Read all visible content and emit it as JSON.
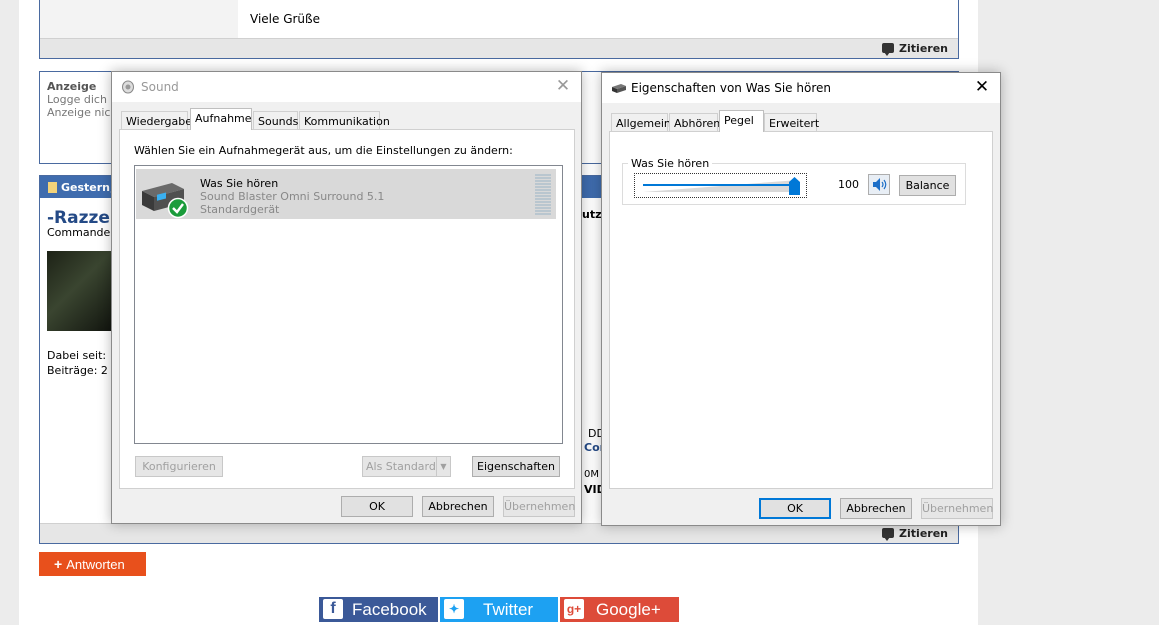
{
  "forum": {
    "greeting": "Viele Grüße",
    "quote_label": "Zitieren",
    "ad_title": "Anzeige",
    "ad_line1": "Logge dich",
    "ad_line2": "Anzeige nic",
    "post_date": "Gestern,",
    "username": "-Razzer",
    "user_rank": "Commande",
    "member_since": "Dabei seit:",
    "posts_count": "Beiträge: 2",
    "peek_utz": "utz",
    "peek_dd": "DD",
    "peek_cor": "Cor",
    "peek_0m": "0M",
    "peek_vid": "VID",
    "reply_button": "Antworten",
    "facebook": "Facebook",
    "twitter": "Twitter",
    "googleplus": "Google+"
  },
  "sound_dialog": {
    "title": "Sound",
    "tabs": [
      "Wiedergabe",
      "Aufnahme",
      "Sounds",
      "Kommunikation"
    ],
    "instruction": "Wählen Sie ein Aufnahmegerät aus, um die Einstellungen zu ändern:",
    "device": {
      "name": "Was Sie hören",
      "hardware": "Sound Blaster Omni Surround 5.1",
      "status": "Standardgerät"
    },
    "configure_button": "Konfigurieren",
    "set_default_button": "Als Standard",
    "properties_button": "Eigenschaften",
    "ok_button": "OK",
    "cancel_button": "Abbrechen",
    "apply_button": "Übernehmen"
  },
  "props_dialog": {
    "title": "Eigenschaften von Was Sie hören",
    "tabs": [
      "Allgemein",
      "Abhören",
      "Pegel",
      "Erweitert"
    ],
    "group_label": "Was Sie hören",
    "level_value": "100",
    "level_fraction": 1.0,
    "balance_button": "Balance",
    "ok_button": "OK",
    "cancel_button": "Abbrechen",
    "apply_button": "Übernehmen"
  },
  "colors": {
    "accent_blue": "#0078d7",
    "reply_orange": "#e8501c",
    "facebook": "#3b5998",
    "twitter": "#1da1f2",
    "googleplus": "#dd4b39",
    "forum_header": "#3f6cae"
  }
}
